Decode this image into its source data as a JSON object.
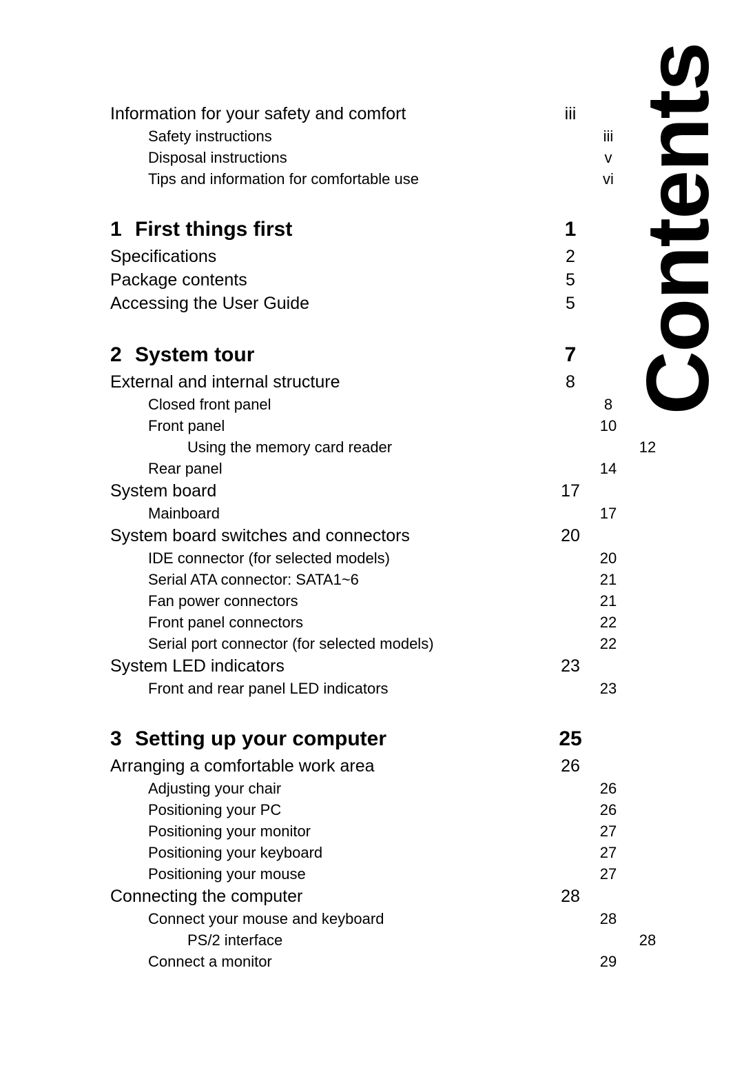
{
  "page": {
    "side_title": "Contents"
  },
  "toc": {
    "blocks": [
      {
        "entries": [
          {
            "level": 1,
            "label": "Information for your safety and comfort",
            "page": "iii"
          },
          {
            "level": 2,
            "label": "Safety instructions",
            "page": "iii"
          },
          {
            "level": 2,
            "label": "Disposal instructions",
            "page": "v"
          },
          {
            "level": 2,
            "label": "Tips and information for comfortable use",
            "page": "vi"
          }
        ]
      },
      {
        "entries": [
          {
            "level": 0,
            "number": "1",
            "label": "First things first",
            "page": "1"
          },
          {
            "level": 1,
            "label": "Specifications",
            "page": "2"
          },
          {
            "level": 1,
            "label": "Package contents",
            "page": "5"
          },
          {
            "level": 1,
            "label": "Accessing the User Guide",
            "page": "5"
          }
        ]
      },
      {
        "entries": [
          {
            "level": 0,
            "number": "2",
            "label": "System tour",
            "page": "7"
          },
          {
            "level": 1,
            "label": "External and internal structure",
            "page": "8"
          },
          {
            "level": 2,
            "label": "Closed front panel",
            "page": "8"
          },
          {
            "level": 2,
            "label": "Front panel",
            "page": "10"
          },
          {
            "level": 3,
            "label": "Using the memory card reader",
            "page": "12"
          },
          {
            "level": 2,
            "label": "Rear panel",
            "page": "14"
          },
          {
            "level": 1,
            "label": "System board",
            "page": "17"
          },
          {
            "level": 2,
            "label": "Mainboard",
            "page": "17"
          },
          {
            "level": 1,
            "label": "System board switches and connectors",
            "page": "20"
          },
          {
            "level": 2,
            "label": "IDE connector (for selected models)",
            "page": "20"
          },
          {
            "level": 2,
            "label": "Serial ATA connector: SATA1~6",
            "page": "21"
          },
          {
            "level": 2,
            "label": "Fan power connectors",
            "page": "21"
          },
          {
            "level": 2,
            "label": "Front panel connectors",
            "page": "22"
          },
          {
            "level": 2,
            "label": "Serial port connector (for selected models)",
            "page": "22"
          },
          {
            "level": 1,
            "label": "System LED indicators",
            "page": "23"
          },
          {
            "level": 2,
            "label": "Front and rear panel LED indicators",
            "page": "23"
          }
        ]
      },
      {
        "entries": [
          {
            "level": 0,
            "number": "3",
            "label": "Setting up your computer",
            "page": "25"
          },
          {
            "level": 1,
            "label": "Arranging a comfortable work area",
            "page": "26"
          },
          {
            "level": 2,
            "label": "Adjusting your chair",
            "page": "26"
          },
          {
            "level": 2,
            "label": "Positioning your PC",
            "page": "26"
          },
          {
            "level": 2,
            "label": "Positioning your monitor",
            "page": "27"
          },
          {
            "level": 2,
            "label": "Positioning your keyboard",
            "page": "27"
          },
          {
            "level": 2,
            "label": "Positioning your mouse",
            "page": "27"
          },
          {
            "level": 1,
            "label": "Connecting the computer",
            "page": "28"
          },
          {
            "level": 2,
            "label": "Connect your mouse and keyboard",
            "page": "28"
          },
          {
            "level": 3,
            "label": "PS/2 interface",
            "page": "28"
          },
          {
            "level": 2,
            "label": "Connect a monitor",
            "page": "29"
          }
        ]
      }
    ]
  }
}
